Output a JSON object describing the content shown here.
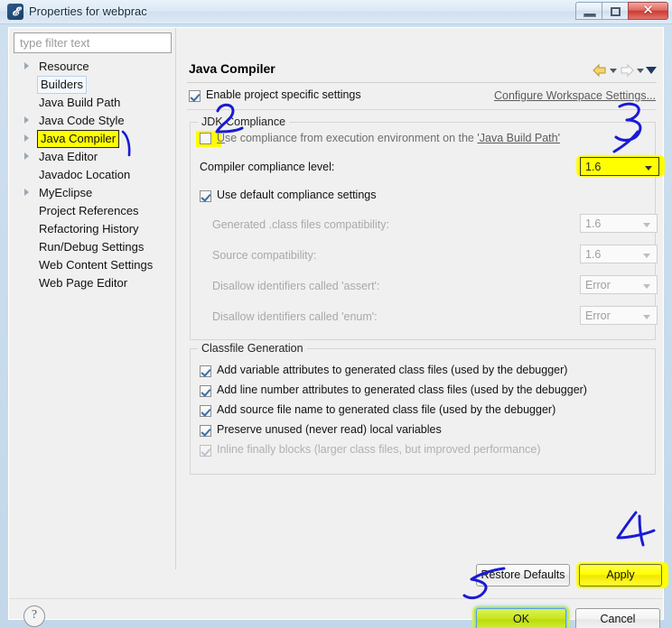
{
  "window": {
    "title": "Properties for webprac",
    "icon": "eclipse-icon",
    "minimize_label": "–",
    "maximize_label": "□",
    "close_label": "✕"
  },
  "filter": {
    "placeholder": "type filter text",
    "value": ""
  },
  "tree": {
    "items": [
      {
        "label": "Resource",
        "expandable": true,
        "state": "normal"
      },
      {
        "label": "Builders",
        "expandable": false,
        "state": "selected"
      },
      {
        "label": "Java Build Path",
        "expandable": false,
        "state": "normal"
      },
      {
        "label": "Java Code Style",
        "expandable": true,
        "state": "normal"
      },
      {
        "label": "Java Compiler",
        "expandable": true,
        "state": "highlighted"
      },
      {
        "label": "Java Editor",
        "expandable": true,
        "state": "normal"
      },
      {
        "label": "Javadoc Location",
        "expandable": false,
        "state": "normal"
      },
      {
        "label": "MyEclipse",
        "expandable": true,
        "state": "normal"
      },
      {
        "label": "Project References",
        "expandable": false,
        "state": "normal"
      },
      {
        "label": "Refactoring History",
        "expandable": false,
        "state": "normal"
      },
      {
        "label": "Run/Debug Settings",
        "expandable": false,
        "state": "normal"
      },
      {
        "label": "Web Content Settings",
        "expandable": false,
        "state": "normal"
      },
      {
        "label": "Web Page Editor",
        "expandable": false,
        "state": "normal"
      }
    ]
  },
  "page": {
    "title": "Java Compiler",
    "enable_specific": {
      "label": "Enable project specific settings",
      "checked": true
    },
    "configure_workspace_link": "Configure Workspace Settings...",
    "jdk_group": {
      "title": "JDK Compliance",
      "use_execution_env": {
        "label_prefix": "U",
        "label_rest": "se compliance from execution environment on the ",
        "link": "'Java Build Path'",
        "checked": false,
        "highlighted": true
      },
      "compliance_level": {
        "label": "Compiler compliance level:",
        "value": "1.6",
        "highlighted": true
      },
      "use_default": {
        "label": "Use default compliance settings",
        "checked": true
      },
      "rows": [
        {
          "label": "Generated .class files compatibility:",
          "value": "1.6",
          "disabled": true
        },
        {
          "label": "Source compatibility:",
          "value": "1.6",
          "disabled": true
        },
        {
          "label": "Disallow identifiers called 'assert':",
          "value": "Error",
          "disabled": true
        },
        {
          "label": "Disallow identifiers called 'enum':",
          "value": "Error",
          "disabled": true
        }
      ]
    },
    "classfile_group": {
      "title": "Classfile Generation",
      "options": [
        {
          "label": "Add variable attributes to generated class files (used by the debugger)",
          "checked": true,
          "disabled": false
        },
        {
          "label": "Add line number attributes to generated class files (used by the debugger)",
          "checked": true,
          "disabled": false
        },
        {
          "label": "Add source file name to generated class file (used by the debugger)",
          "checked": true,
          "disabled": false
        },
        {
          "label": "Preserve unused (never read) local variables",
          "checked": true,
          "disabled": false
        },
        {
          "label": "Inline finally blocks (larger class files, but improved performance)",
          "checked": true,
          "disabled": true
        }
      ]
    }
  },
  "buttons": {
    "restore_defaults": "Restore Defaults",
    "apply": "Apply",
    "ok": "OK",
    "cancel": "Cancel",
    "help": "?"
  },
  "annotations": [
    {
      "id": "1",
      "text": "1",
      "target": "java-compiler-tree-item"
    },
    {
      "id": "2",
      "text": "2",
      "target": "use-execution-environment-checkbox"
    },
    {
      "id": "3",
      "text": "3",
      "target": "compliance-level-combo"
    },
    {
      "id": "4",
      "text": "4",
      "target": "apply-button"
    },
    {
      "id": "5",
      "text": "5",
      "target": "ok-button"
    }
  ],
  "colors": {
    "highlighter": "#ffff00",
    "annotation_ink": "#1a1ad6",
    "title_text": "#10283d",
    "default_button_glow": "#6ec8f5"
  }
}
